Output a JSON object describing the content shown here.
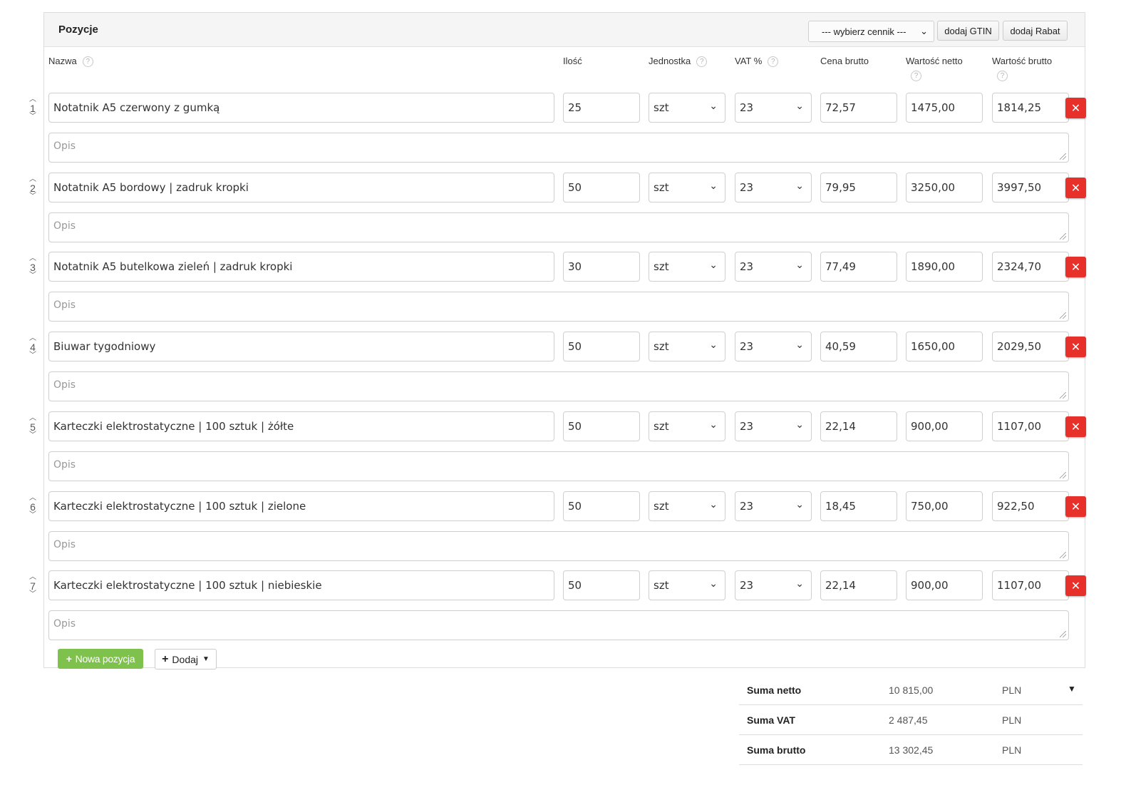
{
  "panel": {
    "title": "Pozycje",
    "pricelist_select": "--- wybierz cennik ---",
    "add_gtin_label": "dodaj GTIN",
    "add_discount_label": "dodaj Rabat"
  },
  "columns": {
    "name": "Nazwa",
    "qty": "Ilość",
    "unit": "Jednostka",
    "vat": "VAT %",
    "gross_price": "Cena brutto",
    "net_value": "Wartość netto",
    "gross_value": "Wartość brutto"
  },
  "description_placeholder": "Opis",
  "items": [
    {
      "num": "1",
      "name": "Notatnik A5 czerwony z gumką",
      "qty": "25",
      "unit": "szt",
      "vat": "23",
      "price": "72,57",
      "net": "1475,00",
      "gross": "1814,25"
    },
    {
      "num": "2",
      "name": "Notatnik A5 bordowy | zadruk kropki",
      "qty": "50",
      "unit": "szt",
      "vat": "23",
      "price": "79,95",
      "net": "3250,00",
      "gross": "3997,50"
    },
    {
      "num": "3",
      "name": "Notatnik A5 butelkowa zieleń | zadruk kropki",
      "qty": "30",
      "unit": "szt",
      "vat": "23",
      "price": "77,49",
      "net": "1890,00",
      "gross": "2324,70"
    },
    {
      "num": "4",
      "name": "Biuwar tygodniowy",
      "qty": "50",
      "unit": "szt",
      "vat": "23",
      "price": "40,59",
      "net": "1650,00",
      "gross": "2029,50"
    },
    {
      "num": "5",
      "name": "Karteczki elektrostatyczne | 100 sztuk | żółte",
      "qty": "50",
      "unit": "szt",
      "vat": "23",
      "price": "22,14",
      "net": "900,00",
      "gross": "1107,00"
    },
    {
      "num": "6",
      "name": "Karteczki elektrostatyczne | 100 sztuk | zielone",
      "qty": "50",
      "unit": "szt",
      "vat": "23",
      "price": "18,45",
      "net": "750,00",
      "gross": "922,50"
    },
    {
      "num": "7",
      "name": "Karteczki elektrostatyczne | 100 sztuk | niebieskie",
      "qty": "50",
      "unit": "szt",
      "vat": "23",
      "price": "22,14",
      "net": "900,00",
      "gross": "1107,00"
    }
  ],
  "actions": {
    "new_item_label": "Nowa pozycja",
    "add_label": "Dodaj"
  },
  "summary": [
    {
      "label": "Suma netto",
      "value": "10 815,00",
      "currency": "PLN"
    },
    {
      "label": "Suma VAT",
      "value": "2 487,45",
      "currency": "PLN"
    },
    {
      "label": "Suma brutto",
      "value": "13 302,45",
      "currency": "PLN"
    }
  ],
  "colors": {
    "delete_red": "#e8302a",
    "new_item_green": "#7fc14d"
  }
}
